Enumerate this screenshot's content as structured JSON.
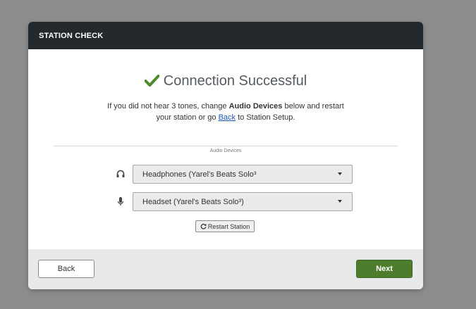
{
  "dialog": {
    "title": "STATION CHECK",
    "status": {
      "icon": "checkmark-icon",
      "text": "Connection Successful",
      "color": "#4d8a2a"
    },
    "instructions": {
      "part1": "If you did not hear 3 tones, change ",
      "bold": "Audio Devices",
      "part2": " below and restart",
      "part3": "your station or go ",
      "link": "Back",
      "part4": " to Station Setup."
    },
    "section_label": "Audio Devices",
    "devices": {
      "output": {
        "icon": "headphones-icon",
        "selected": "Headphones (Yarel's Beats Solo³"
      },
      "input": {
        "icon": "microphone-icon",
        "selected": "Headset (Yarel's Beats Solo³)"
      }
    },
    "restart_label": "Restart Station",
    "footer": {
      "back_label": "Back",
      "next_label": "Next",
      "next_color": "#4d7c2c"
    }
  }
}
